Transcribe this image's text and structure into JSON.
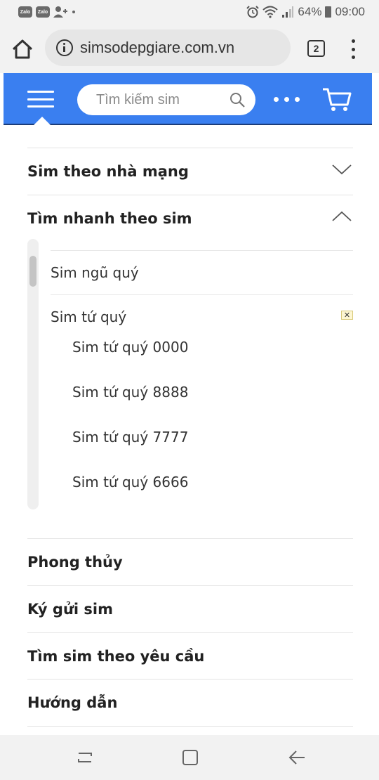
{
  "status_bar": {
    "notifications": [
      "Zalo",
      "Zalo"
    ],
    "battery": "64%",
    "time": "09:00",
    "icons": [
      "person-add-icon",
      "alarm-icon",
      "wifi-icon",
      "signal-icon",
      "battery-icon"
    ]
  },
  "browser": {
    "url": "simsodepgiare.com.vn",
    "tab_count": "2",
    "icons": [
      "home-icon",
      "info-icon",
      "kebab-menu-icon"
    ]
  },
  "header": {
    "search_placeholder": "Tìm kiếm sim",
    "colors": {
      "header_bg": "#3a7ff0",
      "header_border": "#1c3d7a"
    },
    "icons": [
      "hamburger-icon",
      "search-icon",
      "more-dots-icon",
      "cart-icon"
    ]
  },
  "menu": {
    "items": [
      {
        "label": "Sim theo nhà mạng",
        "expanded": false
      },
      {
        "label": "Tìm nhanh theo sim",
        "expanded": true
      },
      {
        "label": "Phong thủy"
      },
      {
        "label": "Ký gửi sim"
      },
      {
        "label": "Tìm sim theo yêu cầu"
      },
      {
        "label": "Hướng dẫn"
      }
    ],
    "subitems": [
      {
        "label": "Sim ngũ quý"
      },
      {
        "label": "Sim tứ quý",
        "expanded": true,
        "close_glyph": "✕"
      }
    ],
    "tu_quy_items": [
      {
        "label": "Sim tứ quý 0000"
      },
      {
        "label": "Sim tứ quý 8888"
      },
      {
        "label": "Sim tứ quý 7777"
      },
      {
        "label": "Sim tứ quý 6666"
      }
    ]
  },
  "nav_bar": {
    "icons": [
      "recent-apps-icon",
      "home-square-icon",
      "back-icon"
    ]
  }
}
